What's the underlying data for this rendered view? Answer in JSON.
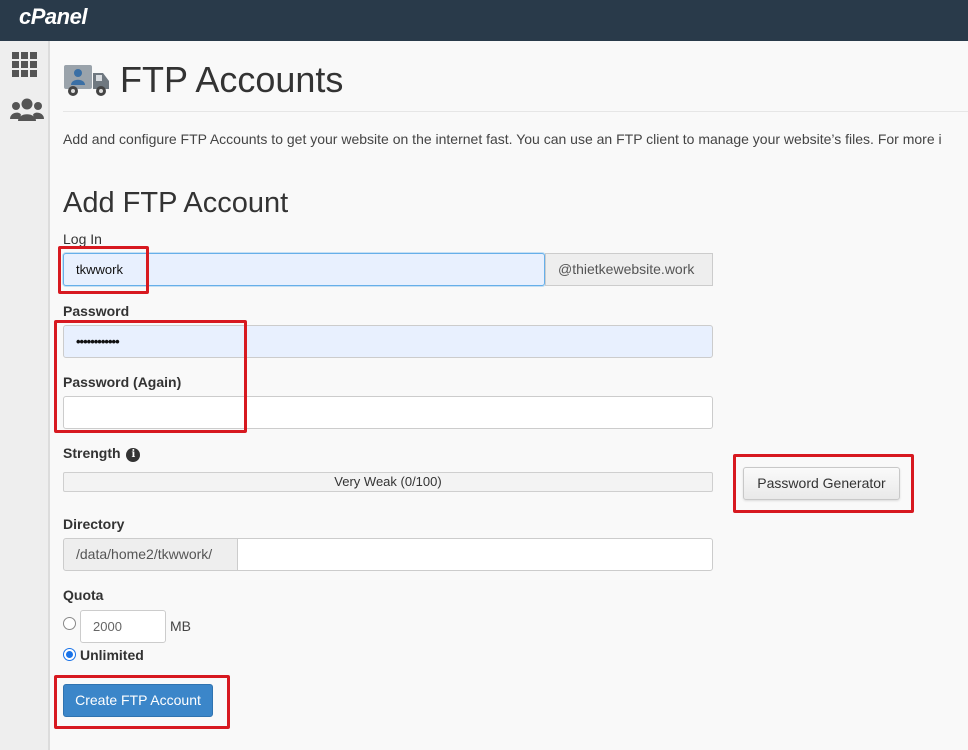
{
  "topbar": {
    "logo": "cPanel"
  },
  "sidebar": {
    "items": [
      {
        "icon": "grid-icon"
      },
      {
        "icon": "users-icon"
      }
    ]
  },
  "page": {
    "title": "FTP Accounts",
    "description": "Add and configure FTP Accounts to get your website on the internet fast. You can use an FTP client to manage your website’s files. For more i"
  },
  "form": {
    "heading": "Add FTP Account",
    "login": {
      "label": "Log In",
      "value": "tkwwork",
      "domain": "@thietkewebsite.work"
    },
    "password": {
      "label": "Password",
      "value": "••••••••••••"
    },
    "password_again": {
      "label": "Password (Again)",
      "value": ""
    },
    "strength": {
      "label": "Strength",
      "text": "Very Weak (0/100)",
      "score": 0,
      "max": 100
    },
    "password_generator_button": "Password Generator",
    "directory": {
      "label": "Directory",
      "prefix": "/data/home2/tkwwork/",
      "value": ""
    },
    "quota": {
      "label": "Quota",
      "value": "2000",
      "unit": "MB",
      "unlimited_label": "Unlimited",
      "selected": "unlimited"
    },
    "submit_button": "Create FTP Account"
  },
  "colors": {
    "topbar": "#293a4a",
    "primary": "#3b86c9",
    "highlight": "#d71920"
  }
}
